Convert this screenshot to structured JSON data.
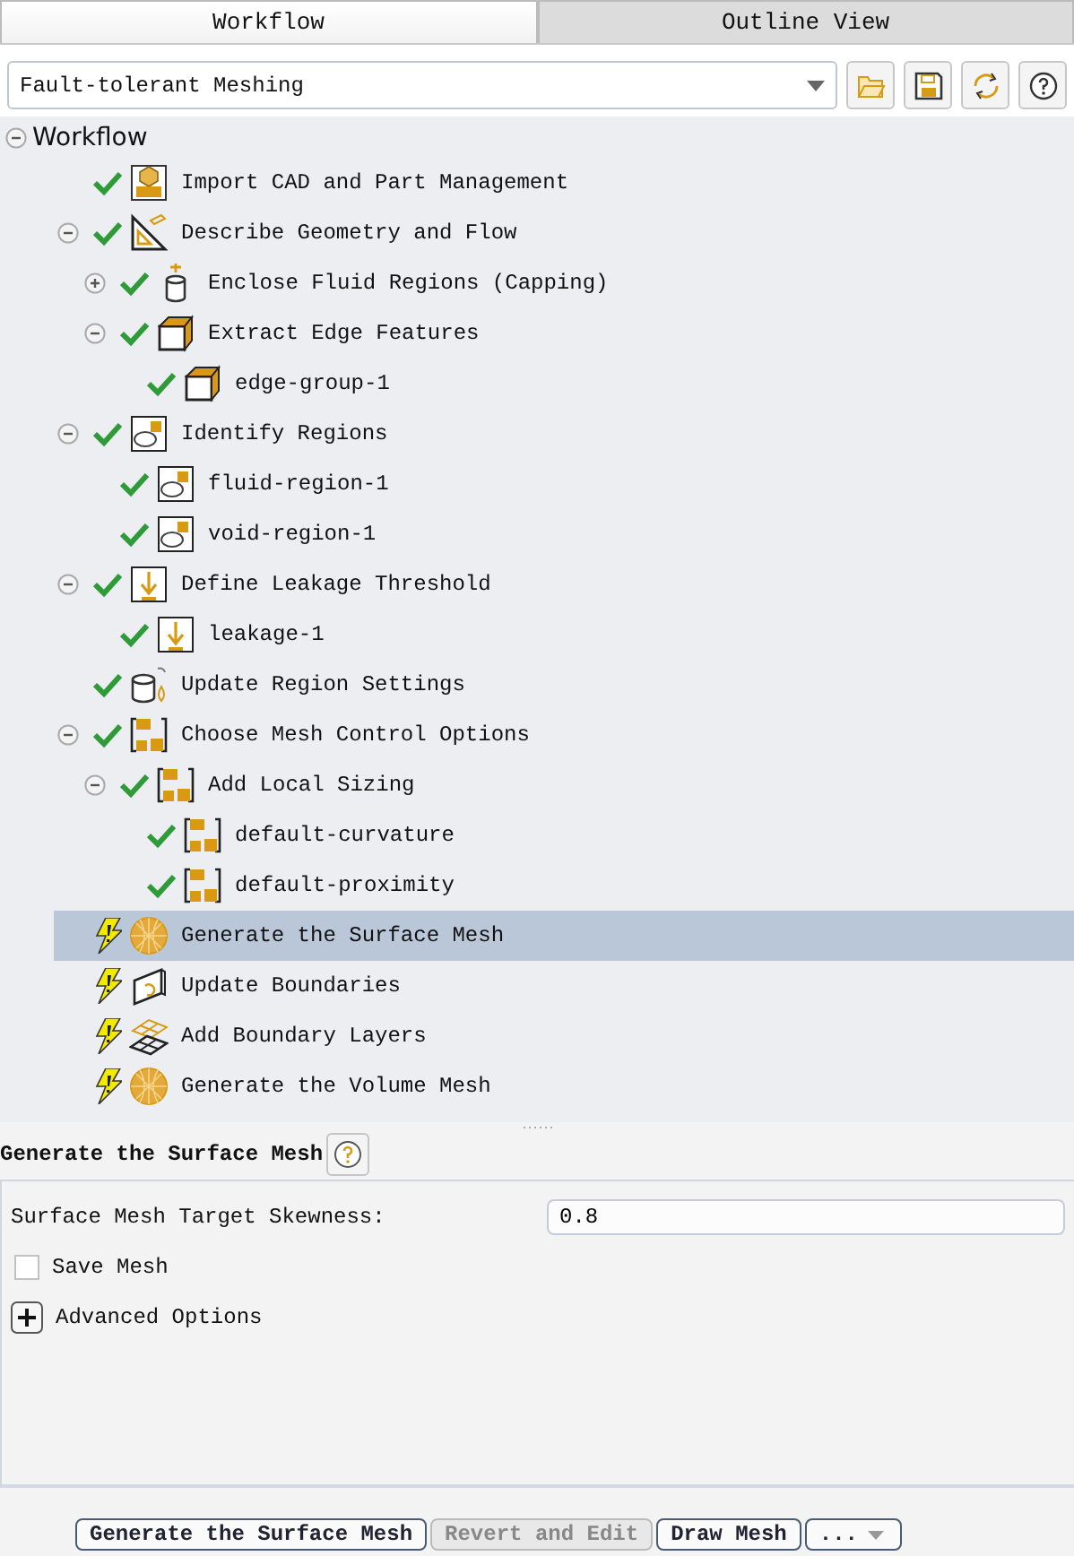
{
  "tabs": [
    {
      "label": "Workflow",
      "selected": true
    },
    {
      "label": "Outline View",
      "selected": false
    }
  ],
  "workflow_select": {
    "value": "Fault-tolerant Meshing"
  },
  "tree": {
    "label": "Workflow",
    "expanded": true,
    "children": [
      {
        "label": "Import CAD and Part Management",
        "done": true,
        "kind": "cad",
        "selected": false
      },
      {
        "label": "Describe Geometry and Flow",
        "done": true,
        "kind": "ruler",
        "selected": false,
        "expanded": true,
        "children": [
          {
            "label": "Enclose Fluid Regions (Capping)",
            "done": true,
            "kind": "cylinder",
            "selected": false,
            "expanded": false
          },
          {
            "label": "Extract Edge Features",
            "done": true,
            "kind": "cube",
            "selected": false,
            "expanded": true,
            "children": [
              {
                "label": "edge-group-1",
                "done": true,
                "kind": "cube",
                "selected": false
              }
            ]
          }
        ]
      },
      {
        "label": "Identify Regions",
        "done": true,
        "kind": "region",
        "selected": false,
        "expanded": true,
        "children": [
          {
            "label": "fluid-region-1",
            "done": true,
            "kind": "region",
            "selected": false
          },
          {
            "label": "void-region-1",
            "done": true,
            "kind": "region",
            "selected": false
          }
        ]
      },
      {
        "label": "Define Leakage Threshold",
        "done": true,
        "kind": "arrow",
        "selected": false,
        "expanded": true,
        "children": [
          {
            "label": "leakage-1",
            "done": true,
            "kind": "arrow",
            "selected": false
          }
        ]
      },
      {
        "label": "Update Region Settings",
        "done": true,
        "kind": "drum",
        "selected": false
      },
      {
        "label": "Choose Mesh Control Options",
        "done": true,
        "kind": "sizing",
        "selected": false,
        "expanded": true,
        "children": [
          {
            "label": "Add Local Sizing",
            "done": true,
            "kind": "sizing",
            "selected": false,
            "expanded": true,
            "children": [
              {
                "label": "default-curvature",
                "done": true,
                "kind": "sizing",
                "selected": false
              },
              {
                "label": "default-proximity",
                "done": true,
                "kind": "sizing",
                "selected": false
              }
            ]
          }
        ]
      },
      {
        "label": "Generate the Surface Mesh",
        "done": false,
        "kind": "sphere",
        "selected": true
      },
      {
        "label": "Update Boundaries",
        "done": false,
        "kind": "boundary",
        "selected": false
      },
      {
        "label": "Add Boundary Layers",
        "done": false,
        "kind": "layers",
        "selected": false
      },
      {
        "label": "Generate the Volume Mesh",
        "done": false,
        "kind": "sphere",
        "selected": false
      }
    ]
  },
  "panel": {
    "title": "Generate the Surface Mesh",
    "fields": [
      {
        "kind": "number",
        "label": "Surface Mesh Target Skewness:",
        "value": "0.8"
      },
      {
        "kind": "checkbox",
        "label": "Save Mesh",
        "checked": false
      },
      {
        "kind": "expander",
        "label": "Advanced Options",
        "expanded": false
      }
    ]
  },
  "buttons": [
    {
      "kind": "button",
      "label": "Generate the Surface Mesh",
      "disabled": false
    },
    {
      "kind": "button",
      "label": "Revert and Edit",
      "disabled": true
    },
    {
      "kind": "button",
      "label": "Draw Mesh",
      "disabled": false
    },
    {
      "kind": "dropdown",
      "label": "...",
      "disabled": false
    }
  ]
}
